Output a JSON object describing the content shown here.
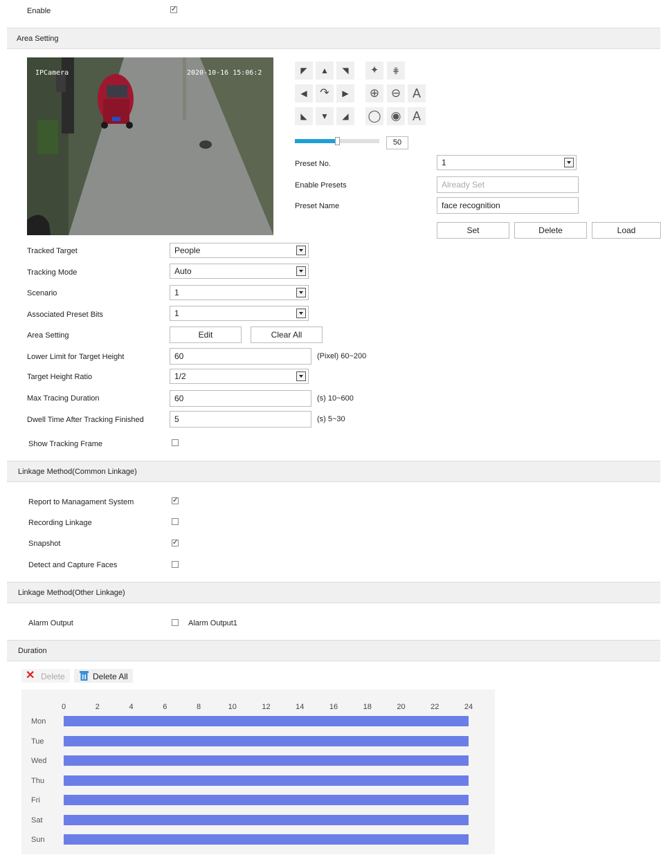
{
  "enable": {
    "label": "Enable",
    "checked": true
  },
  "sections": {
    "area_setting": "Area Setting",
    "linkage_common": "Linkage Method(Common Linkage)",
    "linkage_other": "Linkage Method(Other Linkage)",
    "duration": "Duration"
  },
  "video": {
    "overlay_name": "IPCamera",
    "overlay_time": "2020-10-16 15:06:2",
    "plate": "EV A00"
  },
  "ptz": {
    "speed_value": "50",
    "speed_fraction": 0.5,
    "icons": [
      "arrow-up-left-icon",
      "arrow-up-icon",
      "arrow-up-right-icon",
      "arrow-left-icon",
      "auto-rotate-icon",
      "arrow-right-icon",
      "arrow-down-left-icon",
      "arrow-down-icon",
      "arrow-down-right-icon",
      "wiper-icon",
      "light-icon",
      "zoom-in-icon",
      "zoom-out-icon",
      "focus-near-icon",
      "iris-open-icon",
      "iris-close-icon",
      "focus-far-icon"
    ],
    "focus_letter_1": "A",
    "focus_letter_2": "A"
  },
  "preset": {
    "no_label": "Preset No.",
    "no_value": "1",
    "enable_label": "Enable Presets",
    "enable_placeholder": "Already Set",
    "name_label": "Preset Name",
    "name_value": "face recognition",
    "set": "Set",
    "delete": "Delete",
    "load": "Load"
  },
  "form": {
    "tracked_target": {
      "label": "Tracked Target",
      "value": "People"
    },
    "tracking_mode": {
      "label": "Tracking Mode",
      "value": "Auto"
    },
    "scenario": {
      "label": "Scenario",
      "value": "1"
    },
    "assoc_preset": {
      "label": "Associated Preset Bits",
      "value": "1"
    },
    "area_setting": {
      "label": "Area Setting",
      "edit": "Edit",
      "clear_all": "Clear All"
    },
    "lower_limit": {
      "label": "Lower Limit for Target Height",
      "value": "60",
      "hint": "(Pixel)  60~200"
    },
    "height_ratio": {
      "label": "Target Height Ratio",
      "value": "1/2"
    },
    "max_tracing": {
      "label": "Max Tracing Duration",
      "value": "60",
      "hint": "(s)  10~600"
    },
    "dwell_time": {
      "label": "Dwell Time After Tracking Finished",
      "value": "5",
      "hint": "(s)  5~30"
    },
    "show_frame": {
      "label": "Show Tracking Frame",
      "checked": false
    }
  },
  "common_linkage": {
    "report": {
      "label": "Report to Managament System",
      "checked": true
    },
    "recording": {
      "label": "Recording Linkage",
      "checked": false
    },
    "snapshot": {
      "label": "Snapshot",
      "checked": true
    },
    "faces": {
      "label": "Detect and Capture Faces",
      "checked": false
    }
  },
  "other_linkage": {
    "alarm_output_label": "Alarm Output",
    "alarm_output1": "Alarm Output1",
    "checked": false
  },
  "duration": {
    "delete": "Delete",
    "delete_all": "Delete All",
    "bar_color": "#6b7ee8",
    "hours": [
      "0",
      "2",
      "4",
      "6",
      "8",
      "10",
      "12",
      "14",
      "16",
      "18",
      "20",
      "22",
      "24"
    ],
    "days": [
      "Mon",
      "Tue",
      "Wed",
      "Thu",
      "Fri",
      "Sat",
      "Sun"
    ],
    "schedule": [
      [
        0,
        24
      ],
      [
        0,
        24
      ],
      [
        0,
        24
      ],
      [
        0,
        24
      ],
      [
        0,
        24
      ],
      [
        0,
        24
      ],
      [
        0,
        24
      ]
    ]
  },
  "colors": {
    "accent": "#1e9fd6",
    "section_bg": "#f0f0f0",
    "delete_red": "#e02020",
    "trash_blue": "#3a8fd6"
  }
}
